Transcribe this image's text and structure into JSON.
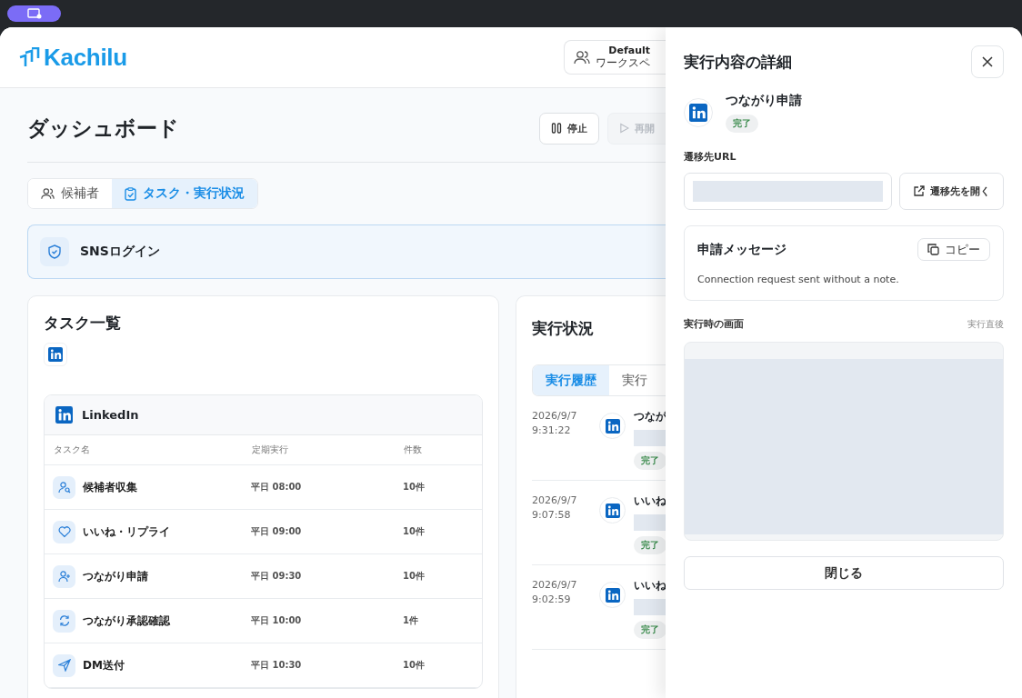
{
  "app": {
    "logo": "Kachilu",
    "workspace": {
      "name": "Default",
      "label": "ワークスペ"
    }
  },
  "page": {
    "title": "ダッシュボード",
    "buttons": [
      {
        "label": "停止",
        "kind": "pause",
        "disabled": false
      },
      {
        "label": "再開",
        "kind": "play",
        "disabled": true
      }
    ]
  },
  "tabs": [
    {
      "label": "候補者",
      "kind": "people",
      "selected": false
    },
    {
      "label": "タスク・実行状況",
      "kind": "clipboard",
      "selected": true
    }
  ],
  "sns_login": {
    "title": "SNSログイン"
  },
  "task_list": {
    "title": "タスク一覧",
    "group": {
      "name": "LinkedIn",
      "columns": [
        "タスク名",
        "定期実行",
        "件数"
      ],
      "rows": [
        {
          "name": "候補者収集",
          "schedule": "平日 08:00",
          "count": "10件"
        },
        {
          "name": "いいね・リプライ",
          "schedule": "平日 09:00",
          "count": "10件"
        },
        {
          "name": "つながり申請",
          "schedule": "平日 09:30",
          "count": "10件"
        },
        {
          "name": "つながり承認確認",
          "schedule": "平日 10:00",
          "count": "1件"
        },
        {
          "name": "DM送付",
          "schedule": "平日 10:30",
          "count": "10件"
        }
      ]
    }
  },
  "execution": {
    "title": "実行状況",
    "tabs": [
      {
        "label": "実行履歴",
        "selected": true
      },
      {
        "label": "実行",
        "selected": false
      }
    ],
    "history": [
      {
        "date": "2026/9/7",
        "time": "9:31:22",
        "title": "つなが",
        "status": "完了"
      },
      {
        "date": "2026/9/7",
        "time": "9:07:58",
        "title": "いいね",
        "status": "完了"
      },
      {
        "date": "2026/9/7",
        "time": "9:02:59",
        "title": "いいね",
        "status": "完了"
      }
    ]
  },
  "detail": {
    "title": "実行内容の詳細",
    "task": "つながり申請",
    "status": "完了",
    "url_label": "遷移先URL",
    "open_button": "遷移先を開く",
    "message": {
      "title": "申請メッセージ",
      "copy_button": "コピー",
      "text": "Connection request sent without a note."
    },
    "screen": {
      "title": "実行時の画面",
      "timing": "実行直後"
    },
    "close_button": "閉じる"
  }
}
